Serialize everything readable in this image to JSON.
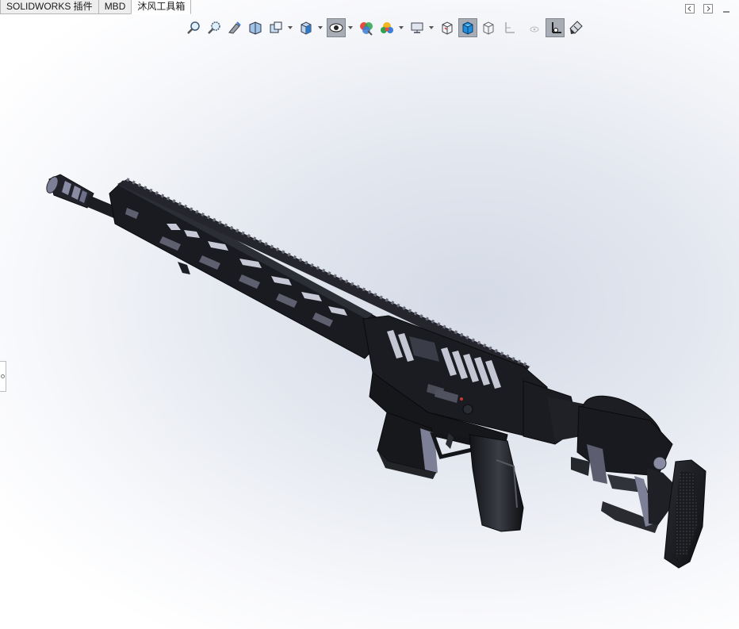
{
  "tabs": [
    {
      "label": "SOLIDWORKS 插件",
      "active": false
    },
    {
      "label": "MBD",
      "active": false
    },
    {
      "label": "沐风工具箱",
      "active": true
    }
  ],
  "heads_up_toolbar": [
    "zoom-to-fit-icon",
    "zoom-to-area-icon",
    "previous-view-icon",
    "section-view-icon",
    "dynamic-annotation-views-icon",
    "view-orientation-icon",
    "display-style-icon",
    "hide-show-items-icon",
    "edit-appearance-icon",
    "apply-scene-icon",
    "view-settings-icon",
    "isometric-view-icon",
    "shaded-view-icon",
    "wireframe-view-icon",
    "display-planes-icon",
    "view-origins-icon",
    "view-coordinate-systems-icon",
    "realview-icon"
  ],
  "colors": {
    "model_body": "#1b1c20",
    "model_highlight": "#8a8c9a",
    "pressed_button": "#a8acb4",
    "viewport_center": "#d4dae6"
  }
}
